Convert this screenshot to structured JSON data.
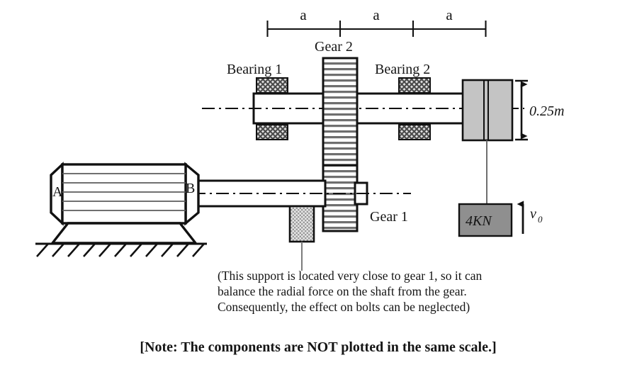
{
  "figure": {
    "title_note": "[Note: The components are NOT plotted in the same scale.]",
    "dimension_labels": [
      "a",
      "a",
      "a"
    ],
    "labels": {
      "gear2": "Gear 2",
      "gear1": "Gear 1",
      "bearing1": "Bearing 1",
      "bearing2": "Bearing 2",
      "motor_left": "A",
      "motor_right": "B",
      "drum_diameter": "0.25m",
      "load": "4KN",
      "velocity": "v",
      "velocity_sub": "0"
    },
    "caption": {
      "line1": "(This support is located very close to gear 1, so it can",
      "line2": "balance the radial force on the shaft from the gear.",
      "line3": "Consequently, the effect on bolts can be neglected)"
    },
    "colors": {
      "outline": "#111111",
      "drum_fill": "#c4c4c4",
      "weight_fill": "#8f8f8f",
      "bearing_fill": "#d5d5d5",
      "support_fill": "#d9d9d9",
      "gear_fill": "#ffffff",
      "background": "#ffffff"
    },
    "icons": {
      "dimension_arrow": "double-arrow-vertical-icon",
      "velocity_arrow": "arrow-up-icon",
      "ground": "ground-hatch-icon",
      "centerline": "center-line-icon"
    }
  }
}
